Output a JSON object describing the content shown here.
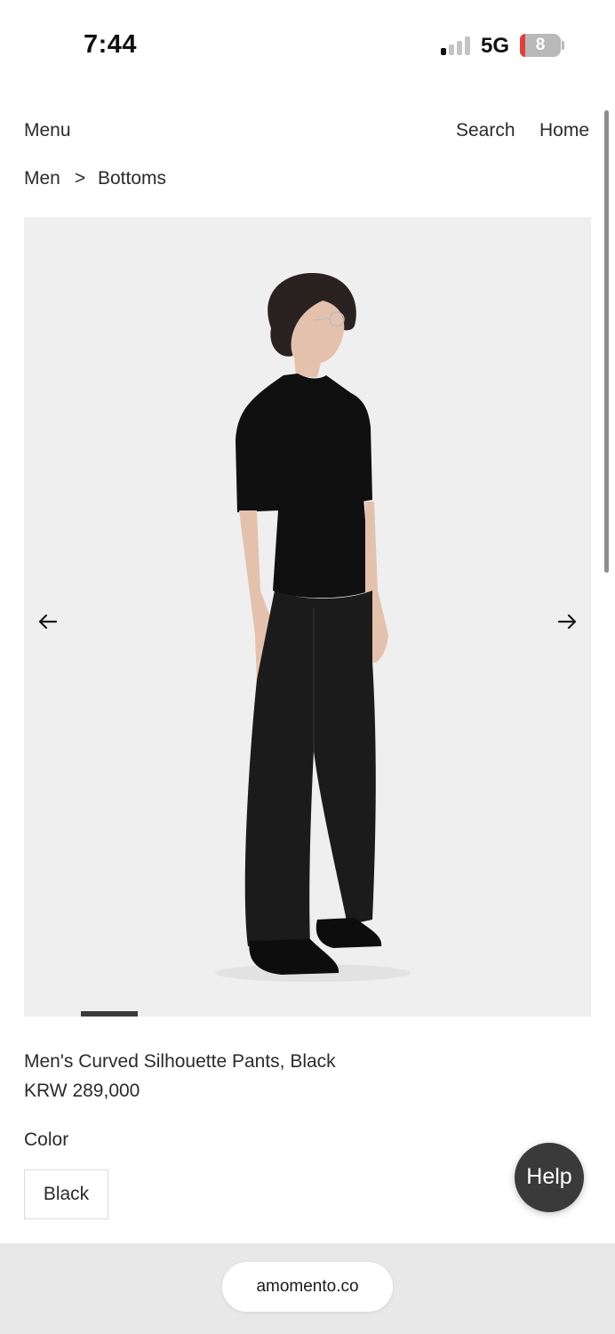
{
  "status_bar": {
    "time": "7:44",
    "network": "5G",
    "battery_level": "8",
    "signal_bars_active": 1,
    "signal_bars_total": 4
  },
  "nav": {
    "menu_label": "Menu",
    "search_label": "Search",
    "home_label": "Home"
  },
  "breadcrumb": {
    "items": [
      "Men",
      "Bottoms"
    ],
    "separator": ">"
  },
  "gallery": {
    "prev_icon": "arrow-left-icon",
    "next_icon": "arrow-right-icon",
    "current_slide_fraction_start": 0.1,
    "current_slide_fraction_width": 0.1
  },
  "product": {
    "name": "Men's Curved Silhouette Pants, Black",
    "price": "KRW 289,000",
    "color_label": "Color",
    "color_options": [
      "Black"
    ]
  },
  "help": {
    "label": "Help"
  },
  "browser": {
    "url": "amomento.co"
  },
  "colors": {
    "text": "#2b2b2b",
    "gallery_bg": "#efefef",
    "help_bg": "#3a3a3a",
    "bottom_bar_bg": "#e8e8e8",
    "battery_low": "#e0413a"
  }
}
